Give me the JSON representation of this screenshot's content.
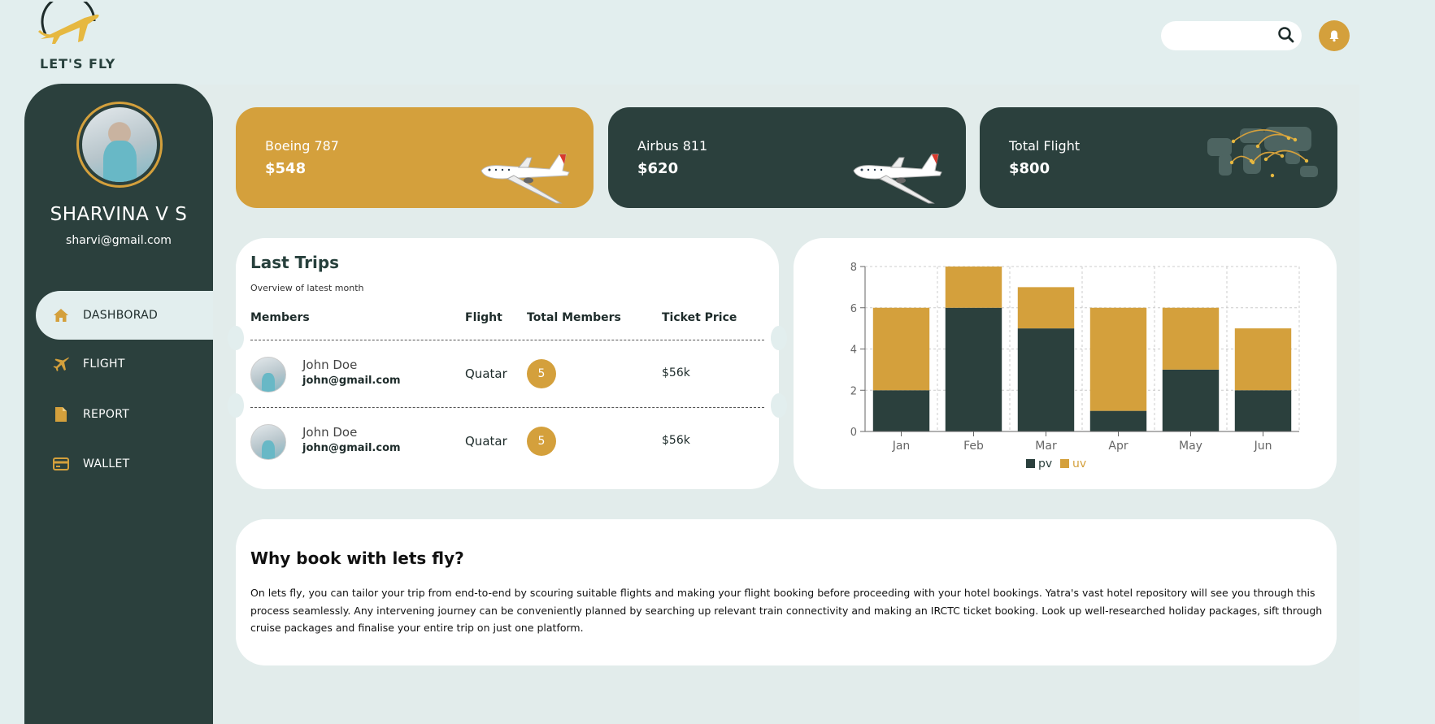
{
  "brand": {
    "name": "LET'S FLY"
  },
  "header": {
    "search_placeholder": "",
    "search_value": ""
  },
  "user": {
    "name": "SHARVINA V S",
    "email": "sharvi@gmail.com"
  },
  "nav": [
    {
      "label": "DASHBORAD",
      "icon": "home-icon",
      "active": true
    },
    {
      "label": "FLIGHT",
      "icon": "plane-icon",
      "active": false
    },
    {
      "label": "REPORT",
      "icon": "file-icon",
      "active": false
    },
    {
      "label": "WALLET",
      "icon": "credit-card-icon",
      "active": false
    }
  ],
  "cards": [
    {
      "title": "Boeing 787",
      "value": "$548"
    },
    {
      "title": "Airbus 811",
      "value": "$620"
    },
    {
      "title": "Total Flight",
      "value": "$800"
    }
  ],
  "trips": {
    "title": "Last Trips",
    "subtitle": "Overview of latest month",
    "headers": [
      "Members",
      "Flight",
      "Total Members",
      "Ticket Price"
    ],
    "rows": [
      {
        "name": "John Doe",
        "email": "john@gmail.com",
        "flight": "Quatar",
        "members": "5",
        "price": "$56k"
      },
      {
        "name": "John Doe",
        "email": "john@gmail.com",
        "flight": "Quatar",
        "members": "5",
        "price": "$56k"
      }
    ]
  },
  "chart_data": {
    "type": "bar",
    "stacked": true,
    "categories": [
      "Jan",
      "Feb",
      "Mar",
      "Apr",
      "May",
      "Jun"
    ],
    "series": [
      {
        "name": "pv",
        "values": [
          2,
          6,
          5,
          1,
          3,
          2
        ],
        "color": "#2b403d"
      },
      {
        "name": "uv",
        "values": [
          4,
          2,
          2,
          5,
          3,
          3
        ],
        "color": "#d4a03c"
      }
    ],
    "ylim": [
      0,
      8
    ],
    "yticks": [
      0,
      2,
      4,
      6,
      8
    ],
    "grid": true,
    "legend": "bottom"
  },
  "about": {
    "title": "Why book with lets fly?",
    "body": "On lets fly, you can tailor your trip from end-to-end by scouring suitable flights and making your flight booking before proceeding with your hotel bookings. Yatra's vast hotel repository will see you through this process seamlessly. Any intervening journey can be conveniently planned by searching up relevant train connectivity and making an IRCTC ticket booking. Look up well-researched holiday packages, sift through cruise packages and finalise your entire trip on just one platform."
  },
  "colors": {
    "gold": "#d4a03c",
    "dark": "#2b403d",
    "bg": "#e2eeee"
  }
}
